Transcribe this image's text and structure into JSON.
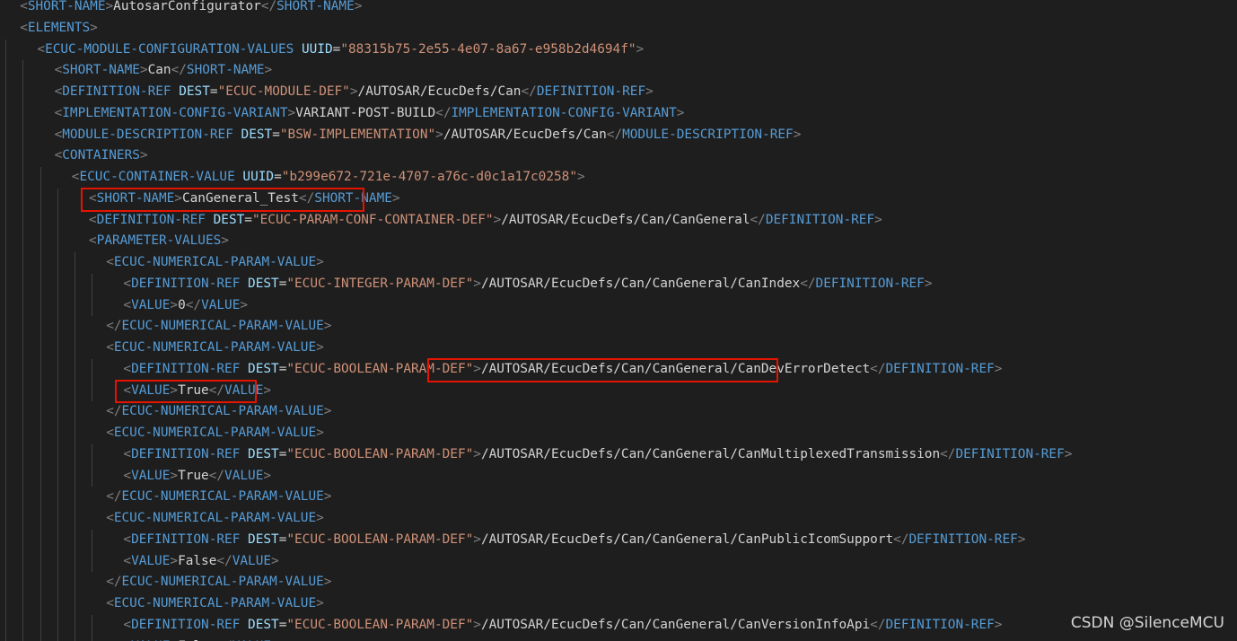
{
  "editor": {
    "lines": [
      {
        "indent": 1,
        "parts": [
          {
            "t": "br",
            "s": "<"
          },
          {
            "t": "tag",
            "s": "SHORT-NAME"
          },
          {
            "t": "br",
            "s": ">"
          },
          {
            "t": "txt",
            "s": "AutosarConfigurator"
          },
          {
            "t": "br",
            "s": "</"
          },
          {
            "t": "tag",
            "s": "SHORT-NAME"
          },
          {
            "t": "br",
            "s": ">"
          }
        ]
      },
      {
        "indent": 1,
        "parts": [
          {
            "t": "br",
            "s": "<"
          },
          {
            "t": "tag",
            "s": "ELEMENTS"
          },
          {
            "t": "br",
            "s": ">"
          }
        ]
      },
      {
        "indent": 2,
        "parts": [
          {
            "t": "br",
            "s": "<"
          },
          {
            "t": "tag",
            "s": "ECUC-MODULE-CONFIGURATION-VALUES"
          },
          {
            "t": "txt",
            "s": " "
          },
          {
            "t": "attr",
            "s": "UUID"
          },
          {
            "t": "txt",
            "s": "="
          },
          {
            "t": "val",
            "s": "\"88315b75-2e55-4e07-8a67-e958b2d4694f\""
          },
          {
            "t": "br",
            "s": ">"
          }
        ]
      },
      {
        "indent": 3,
        "parts": [
          {
            "t": "br",
            "s": "<"
          },
          {
            "t": "tag",
            "s": "SHORT-NAME"
          },
          {
            "t": "br",
            "s": ">"
          },
          {
            "t": "txt",
            "s": "Can"
          },
          {
            "t": "br",
            "s": "</"
          },
          {
            "t": "tag",
            "s": "SHORT-NAME"
          },
          {
            "t": "br",
            "s": ">"
          }
        ]
      },
      {
        "indent": 3,
        "parts": [
          {
            "t": "br",
            "s": "<"
          },
          {
            "t": "tag",
            "s": "DEFINITION-REF"
          },
          {
            "t": "txt",
            "s": " "
          },
          {
            "t": "attr",
            "s": "DEST"
          },
          {
            "t": "txt",
            "s": "="
          },
          {
            "t": "val",
            "s": "\"ECUC-MODULE-DEF\""
          },
          {
            "t": "br",
            "s": ">"
          },
          {
            "t": "txt",
            "s": "/AUTOSAR/EcucDefs/Can"
          },
          {
            "t": "br",
            "s": "</"
          },
          {
            "t": "tag",
            "s": "DEFINITION-REF"
          },
          {
            "t": "br",
            "s": ">"
          }
        ]
      },
      {
        "indent": 3,
        "parts": [
          {
            "t": "br",
            "s": "<"
          },
          {
            "t": "tag",
            "s": "IMPLEMENTATION-CONFIG-VARIANT"
          },
          {
            "t": "br",
            "s": ">"
          },
          {
            "t": "txt",
            "s": "VARIANT-POST-BUILD"
          },
          {
            "t": "br",
            "s": "</"
          },
          {
            "t": "tag",
            "s": "IMPLEMENTATION-CONFIG-VARIANT"
          },
          {
            "t": "br",
            "s": ">"
          }
        ]
      },
      {
        "indent": 3,
        "parts": [
          {
            "t": "br",
            "s": "<"
          },
          {
            "t": "tag",
            "s": "MODULE-DESCRIPTION-REF"
          },
          {
            "t": "txt",
            "s": " "
          },
          {
            "t": "attr",
            "s": "DEST"
          },
          {
            "t": "txt",
            "s": "="
          },
          {
            "t": "val",
            "s": "\"BSW-IMPLEMENTATION\""
          },
          {
            "t": "br",
            "s": ">"
          },
          {
            "t": "txt",
            "s": "/AUTOSAR/EcucDefs/Can"
          },
          {
            "t": "br",
            "s": "</"
          },
          {
            "t": "tag",
            "s": "MODULE-DESCRIPTION-REF"
          },
          {
            "t": "br",
            "s": ">"
          }
        ]
      },
      {
        "indent": 3,
        "parts": [
          {
            "t": "br",
            "s": "<"
          },
          {
            "t": "tag",
            "s": "CONTAINERS"
          },
          {
            "t": "br",
            "s": ">"
          }
        ]
      },
      {
        "indent": 4,
        "parts": [
          {
            "t": "br",
            "s": "<"
          },
          {
            "t": "tag",
            "s": "ECUC-CONTAINER-VALUE"
          },
          {
            "t": "txt",
            "s": " "
          },
          {
            "t": "attr",
            "s": "UUID"
          },
          {
            "t": "txt",
            "s": "="
          },
          {
            "t": "val",
            "s": "\"b299e672-721e-4707-a76c-d0c1a17c0258\""
          },
          {
            "t": "br",
            "s": ">"
          }
        ]
      },
      {
        "indent": 5,
        "parts": [
          {
            "t": "br",
            "s": "<"
          },
          {
            "t": "tag",
            "s": "SHORT-NAME"
          },
          {
            "t": "br",
            "s": ">"
          },
          {
            "t": "txt",
            "s": "CanGeneral_Test"
          },
          {
            "t": "br",
            "s": "</"
          },
          {
            "t": "tag",
            "s": "SHORT-NAME"
          },
          {
            "t": "br",
            "s": ">"
          }
        ]
      },
      {
        "indent": 5,
        "parts": [
          {
            "t": "br",
            "s": "<"
          },
          {
            "t": "tag",
            "s": "DEFINITION-REF"
          },
          {
            "t": "txt",
            "s": " "
          },
          {
            "t": "attr",
            "s": "DEST"
          },
          {
            "t": "txt",
            "s": "="
          },
          {
            "t": "val",
            "s": "\"ECUC-PARAM-CONF-CONTAINER-DEF\""
          },
          {
            "t": "br",
            "s": ">"
          },
          {
            "t": "txt",
            "s": "/AUTOSAR/EcucDefs/Can/CanGeneral"
          },
          {
            "t": "br",
            "s": "</"
          },
          {
            "t": "tag",
            "s": "DEFINITION-REF"
          },
          {
            "t": "br",
            "s": ">"
          }
        ]
      },
      {
        "indent": 5,
        "parts": [
          {
            "t": "br",
            "s": "<"
          },
          {
            "t": "tag",
            "s": "PARAMETER-VALUES"
          },
          {
            "t": "br",
            "s": ">"
          }
        ]
      },
      {
        "indent": 6,
        "parts": [
          {
            "t": "br",
            "s": "<"
          },
          {
            "t": "tag",
            "s": "ECUC-NUMERICAL-PARAM-VALUE"
          },
          {
            "t": "br",
            "s": ">"
          }
        ]
      },
      {
        "indent": 7,
        "parts": [
          {
            "t": "br",
            "s": "<"
          },
          {
            "t": "tag",
            "s": "DEFINITION-REF"
          },
          {
            "t": "txt",
            "s": " "
          },
          {
            "t": "attr",
            "s": "DEST"
          },
          {
            "t": "txt",
            "s": "="
          },
          {
            "t": "val",
            "s": "\"ECUC-INTEGER-PARAM-DEF\""
          },
          {
            "t": "br",
            "s": ">"
          },
          {
            "t": "txt",
            "s": "/AUTOSAR/EcucDefs/Can/CanGeneral/CanIndex"
          },
          {
            "t": "br",
            "s": "</"
          },
          {
            "t": "tag",
            "s": "DEFINITION-REF"
          },
          {
            "t": "br",
            "s": ">"
          }
        ]
      },
      {
        "indent": 7,
        "parts": [
          {
            "t": "br",
            "s": "<"
          },
          {
            "t": "tag",
            "s": "VALUE"
          },
          {
            "t": "br",
            "s": ">"
          },
          {
            "t": "txt",
            "s": "0"
          },
          {
            "t": "br",
            "s": "</"
          },
          {
            "t": "tag",
            "s": "VALUE"
          },
          {
            "t": "br",
            "s": ">"
          }
        ]
      },
      {
        "indent": 6,
        "parts": [
          {
            "t": "br",
            "s": "</"
          },
          {
            "t": "tag",
            "s": "ECUC-NUMERICAL-PARAM-VALUE"
          },
          {
            "t": "br",
            "s": ">"
          }
        ]
      },
      {
        "indent": 6,
        "parts": [
          {
            "t": "br",
            "s": "<"
          },
          {
            "t": "tag",
            "s": "ECUC-NUMERICAL-PARAM-VALUE"
          },
          {
            "t": "br",
            "s": ">"
          }
        ]
      },
      {
        "indent": 7,
        "parts": [
          {
            "t": "br",
            "s": "<"
          },
          {
            "t": "tag",
            "s": "DEFINITION-REF"
          },
          {
            "t": "txt",
            "s": " "
          },
          {
            "t": "attr",
            "s": "DEST"
          },
          {
            "t": "txt",
            "s": "="
          },
          {
            "t": "val",
            "s": "\"ECUC-BOOLEAN-PARAM-DEF\""
          },
          {
            "t": "br",
            "s": ">"
          },
          {
            "t": "txt",
            "s": "/AUTOSAR/EcucDefs/Can/CanGeneral/CanDevErrorDetect"
          },
          {
            "t": "br",
            "s": "</"
          },
          {
            "t": "tag",
            "s": "DEFINITION-REF"
          },
          {
            "t": "br",
            "s": ">"
          }
        ]
      },
      {
        "indent": 7,
        "parts": [
          {
            "t": "br",
            "s": "<"
          },
          {
            "t": "tag",
            "s": "VALUE"
          },
          {
            "t": "br",
            "s": ">"
          },
          {
            "t": "txt",
            "s": "True"
          },
          {
            "t": "br",
            "s": "</"
          },
          {
            "t": "tag",
            "s": "VALUE"
          },
          {
            "t": "br",
            "s": ">"
          }
        ]
      },
      {
        "indent": 6,
        "parts": [
          {
            "t": "br",
            "s": "</"
          },
          {
            "t": "tag",
            "s": "ECUC-NUMERICAL-PARAM-VALUE"
          },
          {
            "t": "br",
            "s": ">"
          }
        ]
      },
      {
        "indent": 6,
        "parts": [
          {
            "t": "br",
            "s": "<"
          },
          {
            "t": "tag",
            "s": "ECUC-NUMERICAL-PARAM-VALUE"
          },
          {
            "t": "br",
            "s": ">"
          }
        ]
      },
      {
        "indent": 7,
        "parts": [
          {
            "t": "br",
            "s": "<"
          },
          {
            "t": "tag",
            "s": "DEFINITION-REF"
          },
          {
            "t": "txt",
            "s": " "
          },
          {
            "t": "attr",
            "s": "DEST"
          },
          {
            "t": "txt",
            "s": "="
          },
          {
            "t": "val",
            "s": "\"ECUC-BOOLEAN-PARAM-DEF\""
          },
          {
            "t": "br",
            "s": ">"
          },
          {
            "t": "txt",
            "s": "/AUTOSAR/EcucDefs/Can/CanGeneral/CanMultiplexedTransmission"
          },
          {
            "t": "br",
            "s": "</"
          },
          {
            "t": "tag",
            "s": "DEFINITION-REF"
          },
          {
            "t": "br",
            "s": ">"
          }
        ]
      },
      {
        "indent": 7,
        "parts": [
          {
            "t": "br",
            "s": "<"
          },
          {
            "t": "tag",
            "s": "VALUE"
          },
          {
            "t": "br",
            "s": ">"
          },
          {
            "t": "txt",
            "s": "True"
          },
          {
            "t": "br",
            "s": "</"
          },
          {
            "t": "tag",
            "s": "VALUE"
          },
          {
            "t": "br",
            "s": ">"
          }
        ]
      },
      {
        "indent": 6,
        "parts": [
          {
            "t": "br",
            "s": "</"
          },
          {
            "t": "tag",
            "s": "ECUC-NUMERICAL-PARAM-VALUE"
          },
          {
            "t": "br",
            "s": ">"
          }
        ]
      },
      {
        "indent": 6,
        "parts": [
          {
            "t": "br",
            "s": "<"
          },
          {
            "t": "tag",
            "s": "ECUC-NUMERICAL-PARAM-VALUE"
          },
          {
            "t": "br",
            "s": ">"
          }
        ]
      },
      {
        "indent": 7,
        "parts": [
          {
            "t": "br",
            "s": "<"
          },
          {
            "t": "tag",
            "s": "DEFINITION-REF"
          },
          {
            "t": "txt",
            "s": " "
          },
          {
            "t": "attr",
            "s": "DEST"
          },
          {
            "t": "txt",
            "s": "="
          },
          {
            "t": "val",
            "s": "\"ECUC-BOOLEAN-PARAM-DEF\""
          },
          {
            "t": "br",
            "s": ">"
          },
          {
            "t": "txt",
            "s": "/AUTOSAR/EcucDefs/Can/CanGeneral/CanPublicIcomSupport"
          },
          {
            "t": "br",
            "s": "</"
          },
          {
            "t": "tag",
            "s": "DEFINITION-REF"
          },
          {
            "t": "br",
            "s": ">"
          }
        ]
      },
      {
        "indent": 7,
        "parts": [
          {
            "t": "br",
            "s": "<"
          },
          {
            "t": "tag",
            "s": "VALUE"
          },
          {
            "t": "br",
            "s": ">"
          },
          {
            "t": "txt",
            "s": "False"
          },
          {
            "t": "br",
            "s": "</"
          },
          {
            "t": "tag",
            "s": "VALUE"
          },
          {
            "t": "br",
            "s": ">"
          }
        ]
      },
      {
        "indent": 6,
        "parts": [
          {
            "t": "br",
            "s": "</"
          },
          {
            "t": "tag",
            "s": "ECUC-NUMERICAL-PARAM-VALUE"
          },
          {
            "t": "br",
            "s": ">"
          }
        ]
      },
      {
        "indent": 6,
        "parts": [
          {
            "t": "br",
            "s": "<"
          },
          {
            "t": "tag",
            "s": "ECUC-NUMERICAL-PARAM-VALUE"
          },
          {
            "t": "br",
            "s": ">"
          }
        ]
      },
      {
        "indent": 7,
        "parts": [
          {
            "t": "br",
            "s": "<"
          },
          {
            "t": "tag",
            "s": "DEFINITION-REF"
          },
          {
            "t": "txt",
            "s": " "
          },
          {
            "t": "attr",
            "s": "DEST"
          },
          {
            "t": "txt",
            "s": "="
          },
          {
            "t": "val",
            "s": "\"ECUC-BOOLEAN-PARAM-DEF\""
          },
          {
            "t": "br",
            "s": ">"
          },
          {
            "t": "txt",
            "s": "/AUTOSAR/EcucDefs/Can/CanGeneral/CanVersionInfoApi"
          },
          {
            "t": "br",
            "s": "</"
          },
          {
            "t": "tag",
            "s": "DEFINITION-REF"
          },
          {
            "t": "br",
            "s": ">"
          }
        ]
      },
      {
        "indent": 7,
        "parts": [
          {
            "t": "br",
            "s": "<"
          },
          {
            "t": "tag",
            "s": "VALUE"
          },
          {
            "t": "br",
            "s": ">"
          },
          {
            "t": "txt",
            "s": "False"
          },
          {
            "t": "br",
            "s": "</"
          },
          {
            "t": "tag",
            "s": "VALUE"
          },
          {
            "t": "br",
            "s": ">"
          }
        ]
      }
    ],
    "highlights": [
      {
        "line": 9,
        "from": "<SHORT-NAME>",
        "to": "</SHORT-NAME>",
        "include_end": true
      },
      {
        "line": 17,
        "from": "/AUTOSAR",
        "to": "</",
        "include_end": false
      },
      {
        "line": 18,
        "from": "<VALUE>",
        "to": "</VALUE>",
        "include_end": true
      }
    ],
    "highlight_color": "#e51400"
  },
  "watermark": {
    "text": "CSDN @SilenceMCU"
  }
}
